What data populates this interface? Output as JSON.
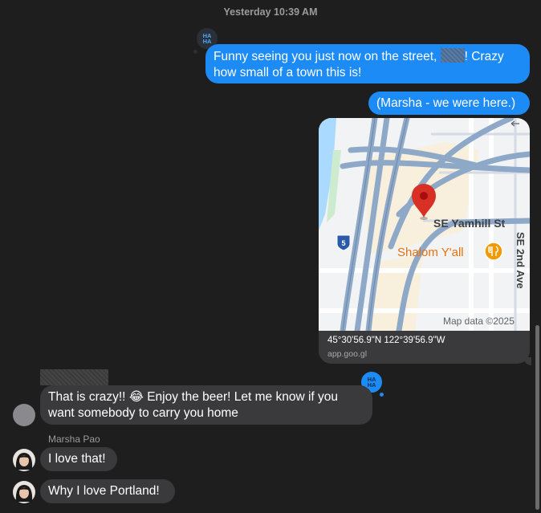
{
  "timestamp": "Yesterday 10:39 AM",
  "tapback_label_line1": "HA",
  "tapback_label_line2": "HA",
  "messages": {
    "outgoing_1_part1": "Funny seeing you just now on the street, ",
    "outgoing_1_part2": "!  Crazy",
    "outgoing_1_line2": "how small of a town this is!",
    "outgoing_2": "(Marsha - we were here.)",
    "incoming_1_line1": "That is crazy!! 😂   Enjoy the beer! Let me know if you",
    "incoming_1_line2": "want somebody to carry you home",
    "incoming_2": "I love that!",
    "incoming_3": "Why I love Portland!"
  },
  "sender_name": "Marsha Pao",
  "map": {
    "street_label": "SE Yamhill St",
    "place_label": "Shalom Y'all",
    "avenue_label": "SE 2nd Ave",
    "highway_shield": "5",
    "attribution": "Map data ©2025",
    "coordinates": "45°30'56.9\"N 122°39'56.9\"W",
    "domain": "app.goo.gl"
  },
  "colors": {
    "background": "#1e1e1e",
    "outgoing_bubble": "#1c8bf5",
    "incoming_bubble": "#3a3a3c",
    "pin_red": "#d93025",
    "place_orange": "#e8710a"
  },
  "icons": {
    "tapback": "haha-tapback-icon",
    "pin": "map-pin-icon",
    "restaurant": "restaurant-icon"
  }
}
